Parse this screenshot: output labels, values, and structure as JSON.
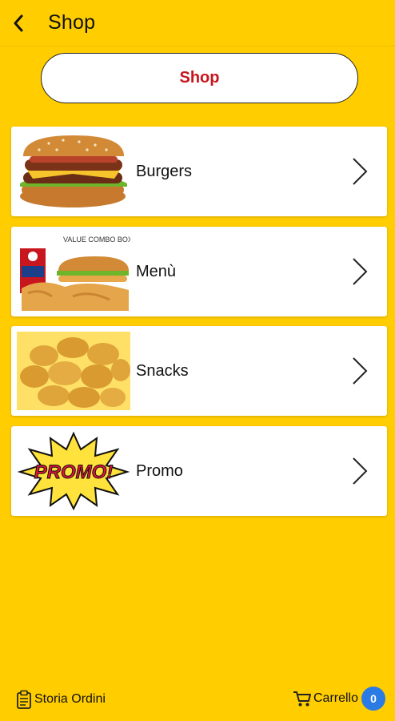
{
  "header": {
    "title": "Shop",
    "back_icon": "chevron-left-icon"
  },
  "shop_button": {
    "label": "Shop",
    "color": "#C8161E"
  },
  "categories": [
    {
      "label": "Burgers",
      "image": "burger-image"
    },
    {
      "label": "Menù",
      "image": "combo-menu-image",
      "image_text": "VALUE COMBO BOX"
    },
    {
      "label": "Snacks",
      "image": "chicken-nuggets-image"
    },
    {
      "label": "Promo",
      "image": "promo-burst-image",
      "image_text": "PROMO!"
    }
  ],
  "footer": {
    "orders_label": "Storia Ordini",
    "orders_icon": "clipboard-icon",
    "cart_label": "Carrello",
    "cart_icon": "cart-icon",
    "cart_count": "0"
  },
  "colors": {
    "background": "#FFCD00",
    "accent": "#C8161E",
    "badge": "#2B7BE5"
  }
}
